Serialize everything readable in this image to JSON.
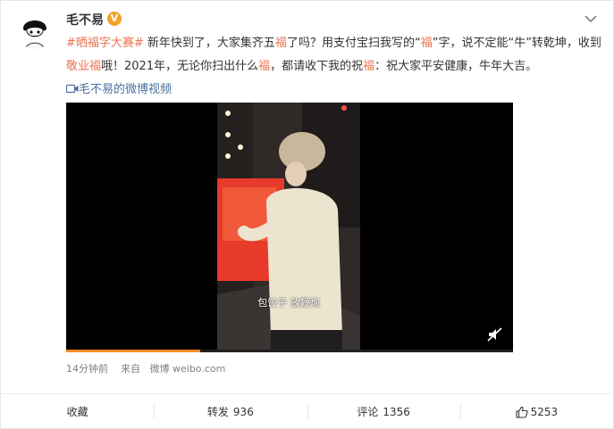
{
  "post": {
    "username": "毛不易",
    "verified_badge": "V",
    "text_segments": {
      "hashtag": "#晒福字大赛#",
      "t1": " 新年快到了，大家集齐五",
      "fu1": "福",
      "t2": "了吗？用支付宝扫我写的“",
      "fu2": "福",
      "t3": "”字，说不定能“牛”转乾坤，收到",
      "jingyefu": "敬业福",
      "t4": "哦！2021年，无论你扫出什么",
      "fu3": "福",
      "t5": "，都请收下我的祝",
      "fu4": "福",
      "t6": "：祝大家平安健康，牛年大吉。"
    },
    "video_link_label": "毛不易的微博视频"
  },
  "video": {
    "caption": "包饺子 放鞭炮",
    "progress": 0.3
  },
  "meta": {
    "time": "14分钟前",
    "from_prefix": "来自",
    "source": "微博 weibo.com"
  },
  "actions": {
    "favorite": {
      "label": "收藏"
    },
    "repost": {
      "label": "转发",
      "count": "936"
    },
    "comment": {
      "label": "评论",
      "count": "1356"
    },
    "like": {
      "count": "5253"
    }
  },
  "colors": {
    "highlight": "#eb7350",
    "link_blue": "#4a6f9f",
    "verified": "#f2a12b",
    "progress": "#f28c28"
  },
  "icons": [
    "avatar",
    "verified-badge-icon",
    "chevron-down-icon",
    "video-camera-icon",
    "mute-icon",
    "thumbs-up-icon"
  ]
}
